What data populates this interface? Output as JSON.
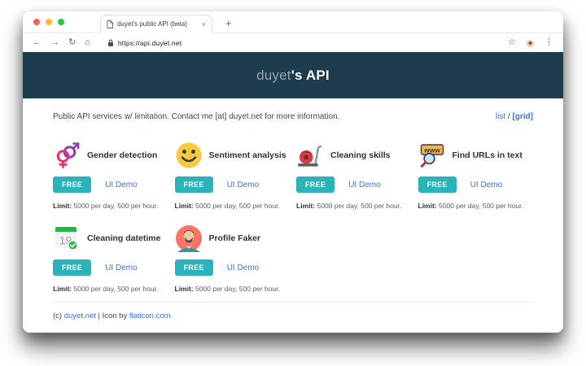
{
  "browser": {
    "tab_title": "duyet's public API (beta)",
    "tab_close": "×",
    "new_tab": "+",
    "back": "←",
    "forward": "→",
    "reload": "↻",
    "home": "⌂",
    "url": "https://api.duyet.net",
    "bookmark_star": "☆",
    "menu_dots": "⋮"
  },
  "header": {
    "title_muted": "duyet",
    "title_strong": "'s API"
  },
  "intro": {
    "text": "Public API services w/ limitation. Contact me [at] duyet.net for more information.",
    "view_list": "list",
    "view_sep": " / ",
    "view_grid": "[grid]"
  },
  "cards": [
    {
      "name": "Gender detection",
      "icon": "gender-icon",
      "badge": "FREE",
      "demo": "UI Demo",
      "limit_label": "Limit:",
      "limit_text": " 5000 per day, 500 per hour."
    },
    {
      "name": "Sentiment analysis",
      "icon": "smiley-icon",
      "badge": "FREE",
      "demo": "UI Demo",
      "limit_label": "Limit:",
      "limit_text": " 5000 per day, 500 per hour."
    },
    {
      "name": "Cleaning skills",
      "icon": "vacuum-icon",
      "badge": "FREE",
      "demo": "UI Demo",
      "limit_label": "Limit:",
      "limit_text": " 5000 per day, 500 per hour."
    },
    {
      "name": "Find URLs in text",
      "icon": "www-search-icon",
      "badge": "FREE",
      "demo": "UI Demo",
      "limit_label": "Limit:",
      "limit_text": " 5000 per day, 500 per hour."
    },
    {
      "name": "Cleaning datetime",
      "icon": "calendar-icon",
      "badge": "FREE",
      "demo": "UI Demo",
      "limit_label": "Limit:",
      "limit_text": " 5000 per day, 500 per hour."
    },
    {
      "name": "Profile Faker",
      "icon": "profile-icon",
      "badge": "FREE",
      "demo": "UI Demo",
      "limit_label": "Limit:",
      "limit_text": " 5000 per day, 500 per hour."
    }
  ],
  "footer": {
    "copy": "(c) ",
    "link1": "duyet.net",
    "mid": " | Icon by ",
    "link2": "flaticon.com"
  },
  "colors": {
    "header_bg": "#1d3c4d",
    "badge": "#2bb3ba",
    "link": "#3e6ff0",
    "traffic_red": "#ff5f57",
    "traffic_yellow": "#febc2e",
    "traffic_green": "#28c840"
  }
}
